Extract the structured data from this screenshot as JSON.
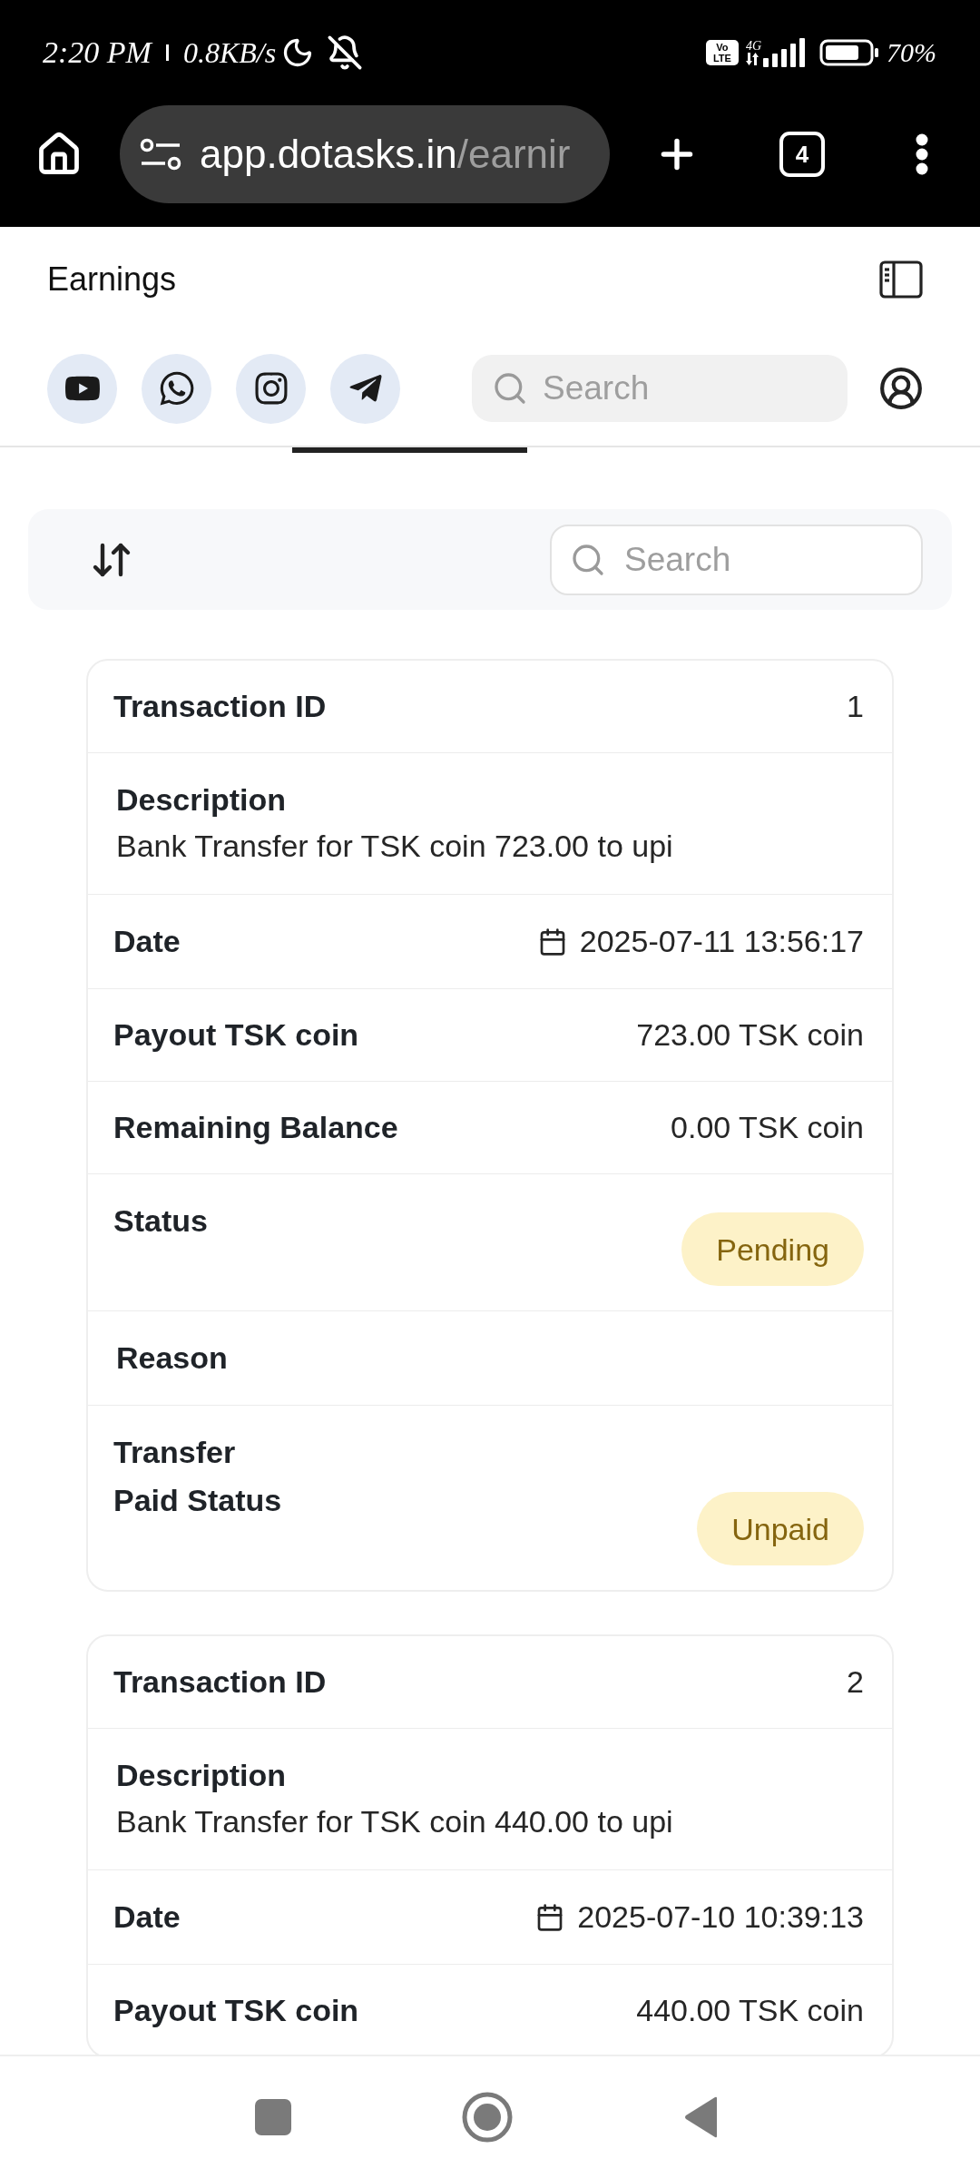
{
  "status_bar": {
    "time": "2:20 PM",
    "network_speed": "0.8KB/s",
    "volte": "Vo LTE",
    "network_type": "4G",
    "battery_percent": "70%"
  },
  "browser": {
    "url_host": "app.dotasks.in",
    "url_path": "/earnir",
    "tab_count": "4"
  },
  "page": {
    "title": "Earnings"
  },
  "header_search": {
    "placeholder": "Search"
  },
  "toolbar": {
    "search": {
      "placeholder": "Search"
    }
  },
  "transactions": [
    {
      "rows": [
        {
          "kind": "inline",
          "label": "Transaction ID",
          "value": "1"
        },
        {
          "kind": "stacked",
          "label": "Description",
          "value": "Bank Transfer for TSK coin 723.00 to upi"
        },
        {
          "kind": "date",
          "label": "Date",
          "value": "2025-07-11 13:56:17"
        },
        {
          "kind": "inline",
          "label": "Payout TSK coin",
          "value": "723.00 TSK coin"
        },
        {
          "kind": "inline",
          "label": "Remaining Balance",
          "value": "0.00 TSK coin"
        },
        {
          "kind": "badge",
          "label": "Status",
          "value": "Pending"
        },
        {
          "kind": "stacked",
          "label": "Reason"
        },
        {
          "kind": "badge",
          "label": "Transfer Paid Status",
          "value": "Unpaid"
        }
      ]
    },
    {
      "rows": [
        {
          "kind": "inline",
          "label": "Transaction ID",
          "value": "2"
        },
        {
          "kind": "stacked",
          "label": "Description",
          "value": "Bank Transfer for TSK coin 440.00 to upi"
        },
        {
          "kind": "date",
          "label": "Date",
          "value": "2025-07-10 10:39:13"
        },
        {
          "kind": "inline",
          "label": "Payout TSK coin",
          "value": "440.00 TSK coin"
        }
      ]
    }
  ]
}
